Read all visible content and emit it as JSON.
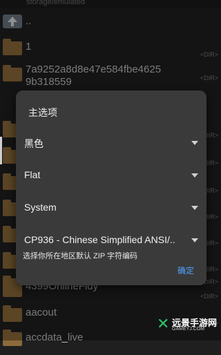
{
  "status": {
    "path": "storage/emulated"
  },
  "files": [
    {
      "name": "..",
      "type": "up",
      "dir": ""
    },
    {
      "name": "1",
      "type": "folder",
      "dir": "<DIR>"
    },
    {
      "name": "7a9252a8d8e47e584fbe4625",
      "name2": "9b318559",
      "type": "folder",
      "dir": "<DIR>"
    },
    {
      "name": "",
      "type": "folder",
      "dir": "<DIR>"
    },
    {
      "name": "",
      "type": "folder",
      "dir": "<DIR>"
    },
    {
      "name": "",
      "type": "folder",
      "dir": "<DIR>"
    },
    {
      "name": "",
      "type": "folder",
      "dir": "<DIR>"
    },
    {
      "name": "",
      "type": "folder",
      "dir": "<DIR>"
    },
    {
      "name": "",
      "type": "folder",
      "dir": "<DIR>"
    },
    {
      "name": "",
      "type": "folder",
      "dir": "<DIR>"
    },
    {
      "name": "4399OnlineFidy",
      "type": "folder",
      "dir": "<DIR>"
    },
    {
      "name": "aacout",
      "type": "folder",
      "dir": "<DIR>"
    },
    {
      "name": "accdata_live",
      "type": "folder",
      "dir": ""
    }
  ],
  "dialog": {
    "title": "主选项",
    "options": [
      "黑色",
      "Flat",
      "System",
      "CP936 - Chinese Simplified ANSI/.."
    ],
    "hint": "选择你所在地区默认 ZIP 字符编码",
    "ok": "确定"
  },
  "watermark": {
    "name": "远景手游网",
    "url": "GAMEYJ.COM"
  },
  "colors": {
    "accent": "#4fa3ff",
    "folder": "#8c6a3a",
    "dialog_bg": "#3a3a3a"
  }
}
